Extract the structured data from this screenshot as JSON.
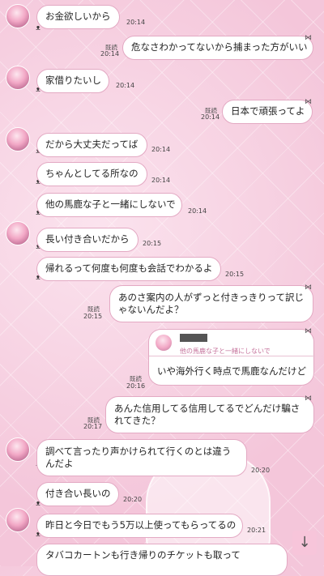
{
  "messages": [
    {
      "side": "left",
      "text": "お金欲しいから",
      "time": "20:14"
    },
    {
      "side": "right",
      "text": "危なさわかってないから捕まった方がいい",
      "time": "20:14",
      "read": "既読"
    },
    {
      "side": "left",
      "text": "家借りたいし",
      "time": "20:14"
    },
    {
      "side": "right",
      "text": "日本で頑張ってよ",
      "time": "20:14",
      "read": "既読"
    },
    {
      "side": "left",
      "text": "だから大丈夫だってば",
      "time": "20:14"
    },
    {
      "side": "left",
      "text": "ちゃんとしてる所なの",
      "time": "20:14"
    },
    {
      "side": "left",
      "text": "他の馬鹿な子と一緒にしないで",
      "time": "20:14"
    },
    {
      "side": "left",
      "text": "長い付き合いだから",
      "time": "20:15"
    },
    {
      "side": "left",
      "text": "帰れるって何度も何度も会話でわかるよ",
      "time": "20:15"
    },
    {
      "side": "right",
      "text": "あのさ案内の人がずっと付きっきりって訳じゃないんだよ？",
      "time": "20:15",
      "read": "既読"
    },
    {
      "side": "right",
      "text": "いや海外行く時点で馬鹿なんだけど",
      "time": "20:16",
      "read": "既読",
      "quote": "他の馬鹿な子と一緒にしないで"
    },
    {
      "side": "right",
      "text": "あんた信用してる信用してるでどんだけ騙されてきた？",
      "time": "20:17",
      "read": "既読"
    },
    {
      "side": "left",
      "text": "調べて言ったり声かけられて行くのとは違うんだよ",
      "time": "20:20"
    },
    {
      "side": "left",
      "text": "付き合い長いの",
      "time": "20:20"
    },
    {
      "side": "left",
      "text": "昨日と今日でもう5万以上使ってもらってるの",
      "time": "20:21"
    },
    {
      "side": "left",
      "text": "タバコカートンも行き帰りのチケットも取って"
    }
  ],
  "icons": {
    "scroll_down": "arrow-down-icon",
    "bow": "bow-icon",
    "kitty": "kitty-icon"
  }
}
